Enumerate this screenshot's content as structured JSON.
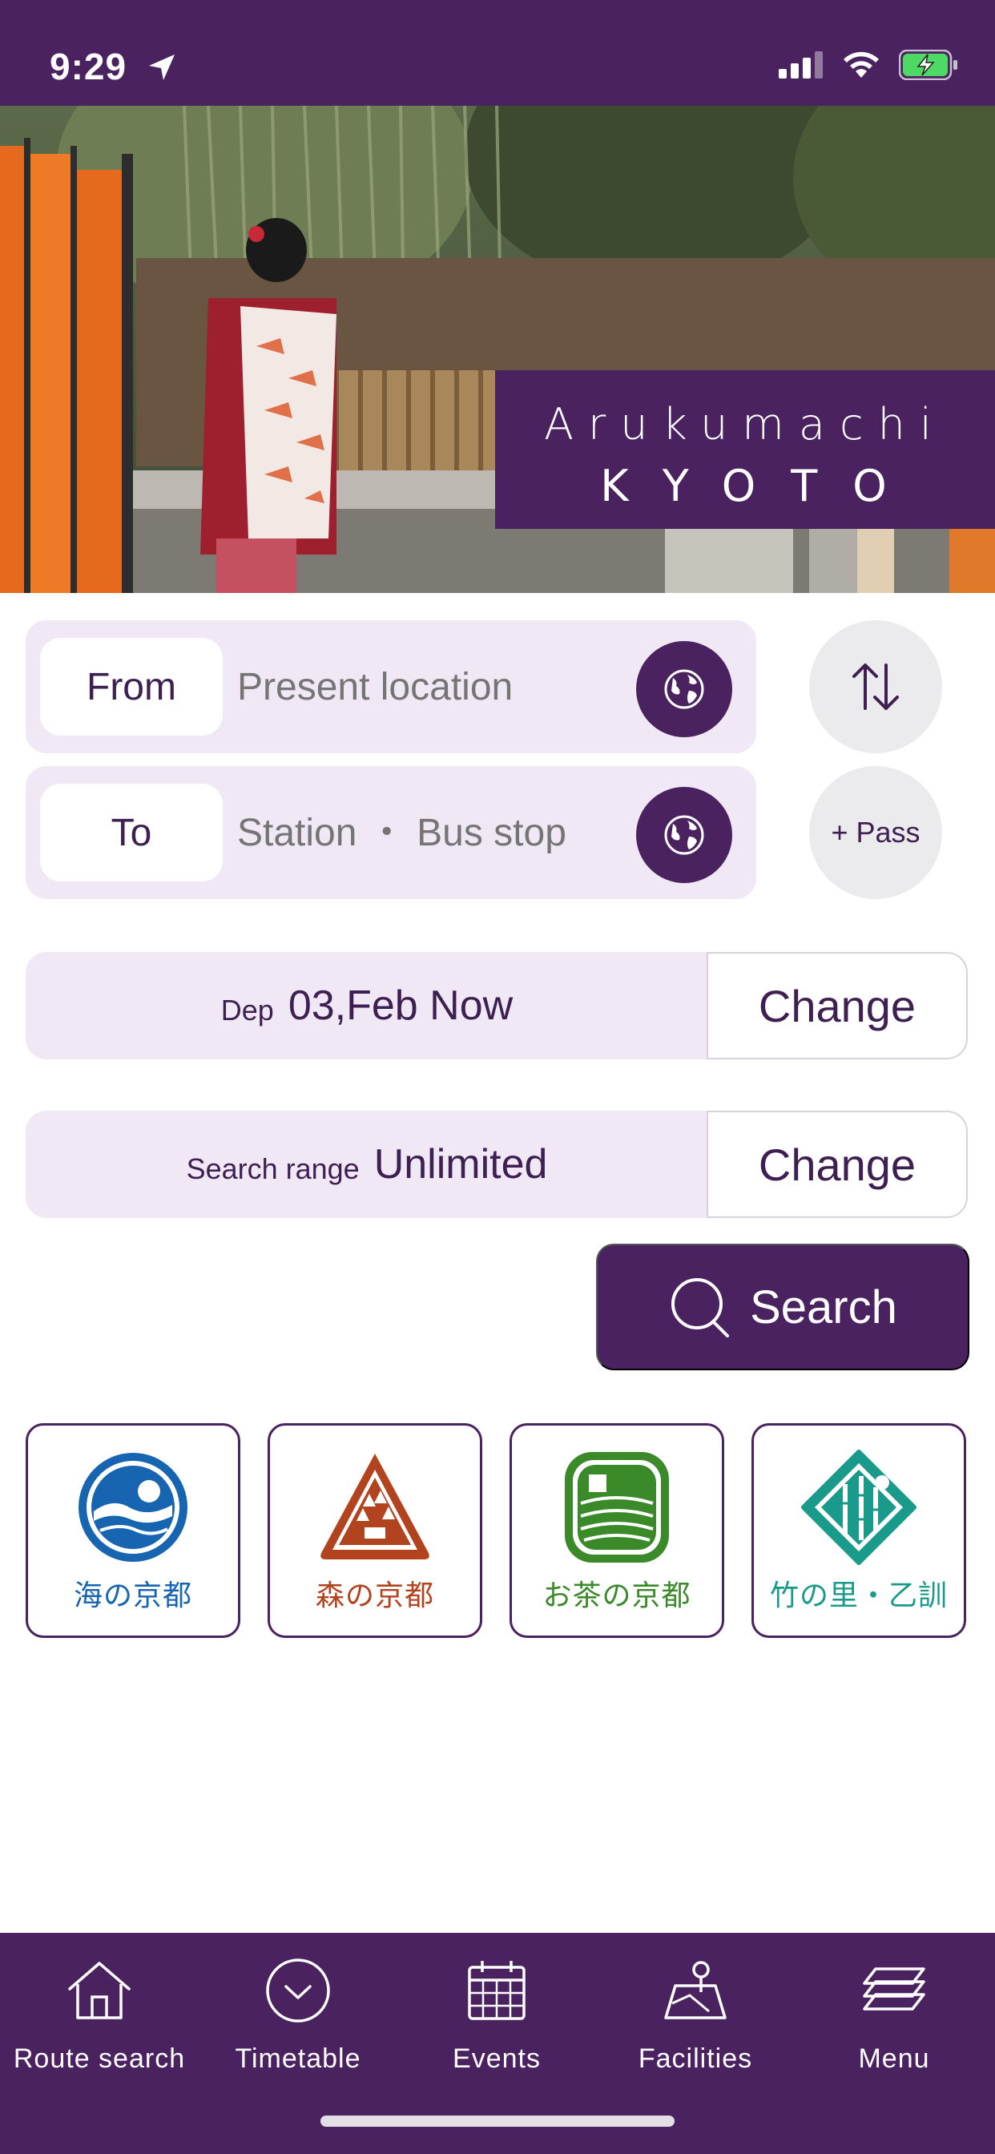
{
  "status_bar": {
    "time": "9:29",
    "icons": [
      "location-arrow-icon",
      "signal-icon",
      "wifi-icon",
      "battery-charging-icon"
    ]
  },
  "hero": {
    "title_line1": "Arukumachi",
    "title_line2": "KYOTO"
  },
  "route": {
    "from_label": "From",
    "from_placeholder": "Present location",
    "to_label": "To",
    "to_placeholder": "Station ・ Bus stop",
    "swap_icon": "swap-arrows-icon",
    "pass_label": "+ Pass"
  },
  "departure": {
    "prefix": "Dep",
    "value": "03,Feb Now",
    "change_label": "Change"
  },
  "search_range": {
    "prefix": "Search range",
    "value": "Unlimited",
    "change_label": "Change"
  },
  "search": {
    "label": "Search",
    "icon": "search-icon"
  },
  "areas": [
    {
      "caption": "海の京都",
      "color": "#1764b0",
      "icon": "sea-kyoto-icon"
    },
    {
      "caption": "森の京都",
      "color": "#b2431f",
      "icon": "forest-kyoto-icon"
    },
    {
      "caption": "お茶の京都",
      "color": "#3a8a2a",
      "icon": "tea-kyoto-icon"
    },
    {
      "caption": "竹の里・乙訓",
      "color": "#1a9a8a",
      "icon": "bamboo-otokuni-icon"
    }
  ],
  "tabs": [
    {
      "label": "Route search",
      "icon": "home-icon"
    },
    {
      "label": "Timetable",
      "icon": "clock-icon"
    },
    {
      "label": "Events",
      "icon": "calendar-icon"
    },
    {
      "label": "Facilities",
      "icon": "map-pin-icon"
    },
    {
      "label": "Menu",
      "icon": "layers-icon"
    }
  ],
  "colors": {
    "brand": "#4a2260",
    "field_bg": "#f0e8f5",
    "placeholder": "#a9a3ad"
  }
}
